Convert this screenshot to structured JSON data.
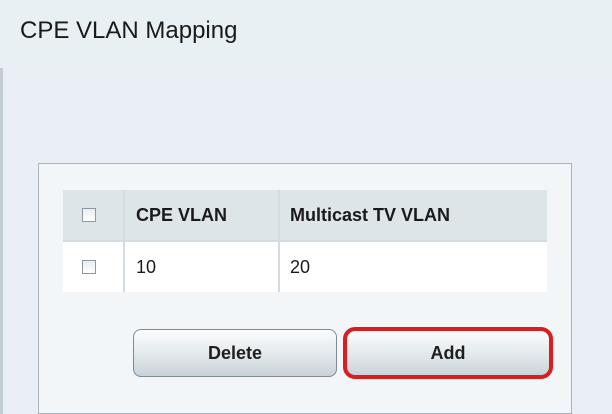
{
  "page": {
    "title": "CPE VLAN Mapping"
  },
  "table": {
    "headers": {
      "cpe_vlan": "CPE VLAN",
      "multicast_tv_vlan": "Multicast TV VLAN"
    },
    "rows": [
      {
        "cpe_vlan": "10",
        "multicast_tv_vlan": "20",
        "selected": false
      }
    ],
    "select_all": false
  },
  "buttons": {
    "delete_label": "Delete",
    "add_label": "Add"
  },
  "colors": {
    "title_bar_bg": "#e8f0f3",
    "panel_bg": "#e9eff4",
    "highlight": "#d81e1e"
  }
}
